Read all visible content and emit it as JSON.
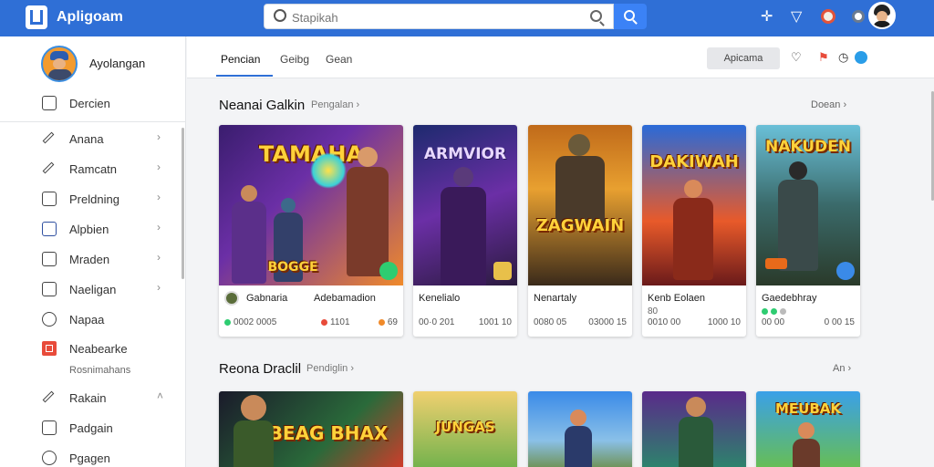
{
  "app": {
    "title": "Apligoam",
    "search_placeholder": "Stapikah"
  },
  "profile": {
    "name": "Ayolangan"
  },
  "sidebar": {
    "items": [
      {
        "label": "Dercien",
        "icon": "package-icon"
      },
      {
        "label": "Anana",
        "icon": "pen-icon"
      },
      {
        "label": "Ramcatn",
        "icon": "pen-icon"
      },
      {
        "label": "Preldning",
        "icon": "screen-icon"
      },
      {
        "label": "Alpbien",
        "icon": "book-icon"
      },
      {
        "label": "Mraden",
        "icon": "lock-icon"
      },
      {
        "label": "Naeligan",
        "icon": "play-icon"
      },
      {
        "label": "Napaa",
        "icon": "globe-icon"
      },
      {
        "label": "Neabearke",
        "icon": "app-icon"
      },
      {
        "label": "Rakain",
        "icon": "pen-icon"
      },
      {
        "label": "Padgain",
        "icon": "image-icon"
      },
      {
        "label": "Pgagen",
        "icon": "refresh-icon"
      }
    ],
    "sub_label": "Rosnimahans"
  },
  "tabs": [
    {
      "label": "Pencian"
    },
    {
      "label": "Geibg"
    },
    {
      "label": "Gean"
    }
  ],
  "tab_action": "Apicama",
  "section1": {
    "title": "Neanai Galkin",
    "sub": "Pengalan ›",
    "more": "Doean ›",
    "cards": [
      {
        "art_title": "TAMAHA",
        "art_sub": "BOGGE",
        "name": "Gabnaria",
        "name2": "Adebamadion",
        "sub": "",
        "meta_l": "0002 0005",
        "meta_r": "1101",
        "meta_r2": "69"
      },
      {
        "art_title": "ARMVIOR",
        "name": "Kenelialo",
        "meta_l": "00·0 201",
        "meta_r": "1001 10"
      },
      {
        "art_title": "ZAGWAIN",
        "name": "Nenartaly",
        "meta_l": "0080 05",
        "meta_r": "03000 15"
      },
      {
        "art_title": "DAKIWAH",
        "name": "Kenb Eolaen",
        "sub": "80",
        "meta_l": "0010 00",
        "meta_r": "1000 10"
      },
      {
        "art_title": "NAKUDEN",
        "name": "Gaedebhray",
        "meta_l": "00 00",
        "meta_r": "0 00 15"
      }
    ]
  },
  "section2": {
    "title": "Reona Draclil",
    "sub": "Pendiglin ›",
    "more": "An ›",
    "cards": [
      {
        "art_title": "BEAG BHAX"
      },
      {
        "art_title": "JUNGAS"
      },
      {
        "art_title": ""
      },
      {
        "art_title": ""
      },
      {
        "art_title": "MEUBAK"
      }
    ]
  },
  "colors": {
    "topbar": "#2f6fd6",
    "accent": "#3b82f6",
    "tab_underline": "#2f6fd6"
  }
}
